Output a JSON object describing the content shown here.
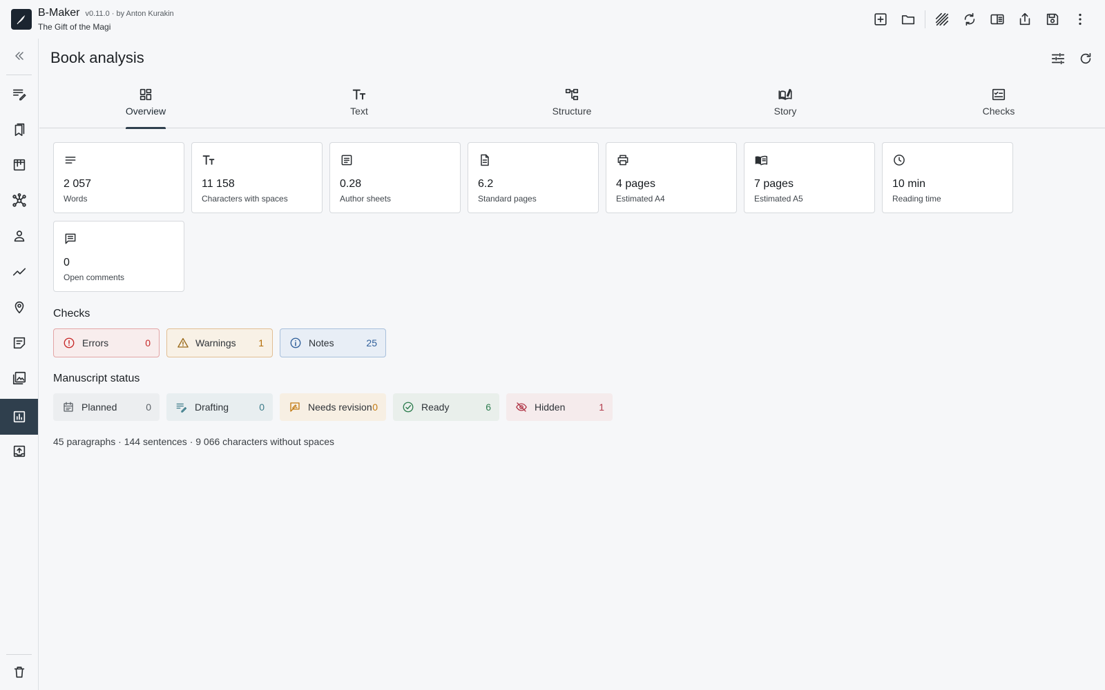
{
  "app": {
    "name": "B-Maker",
    "version": "v0.11.0 · by Anton Kurakin",
    "book_title": "The Gift of the Magi"
  },
  "header_actions": [
    "new-project-icon",
    "open-folder-icon",
    "texture-icon",
    "sync-icon",
    "split-view-icon",
    "share-icon",
    "save-icon",
    "more-vert-icon"
  ],
  "sidebar": {
    "items": [
      "collapse-icon",
      "edit-notes-icon",
      "bookmarks-icon",
      "board-icon",
      "network-icon",
      "person-icon",
      "timeline-icon",
      "location-icon",
      "notes-icon",
      "images-icon",
      "analytics-icon",
      "export-icon"
    ],
    "active": "analytics-icon",
    "bottom": "trash-icon"
  },
  "page": {
    "title": "Book analysis"
  },
  "tabs": [
    {
      "label": "Overview",
      "icon": "dashboard-icon"
    },
    {
      "label": "Text",
      "icon": "text-fields-icon"
    },
    {
      "label": "Structure",
      "icon": "structure-icon"
    },
    {
      "label": "Story",
      "icon": "story-icon"
    },
    {
      "label": "Checks",
      "icon": "checklist-icon"
    }
  ],
  "active_tab": "Overview",
  "stats": [
    {
      "value": "2 057",
      "label": "Words",
      "icon": "lines-icon"
    },
    {
      "value": "11 158",
      "label": "Characters with spaces",
      "icon": "text-fields-icon"
    },
    {
      "value": "0.28",
      "label": "Author sheets",
      "icon": "article-icon"
    },
    {
      "value": "6.2",
      "label": "Standard pages",
      "icon": "document-icon"
    },
    {
      "value": "4 pages",
      "label": "Estimated A4",
      "icon": "print-icon"
    },
    {
      "value": "7 pages",
      "label": "Estimated A5",
      "icon": "book-icon"
    },
    {
      "value": "10 min",
      "label": "Reading time",
      "icon": "clock-icon"
    },
    {
      "value": "0",
      "label": "Open comments",
      "icon": "comment-icon"
    }
  ],
  "checks": {
    "title": "Checks",
    "items": [
      {
        "label": "Errors",
        "count": "0",
        "color": "#c62828"
      },
      {
        "label": "Warnings",
        "count": "1",
        "color": "#b26a00"
      },
      {
        "label": "Notes",
        "count": "25",
        "color": "#2f5f9a"
      }
    ]
  },
  "manuscript_status": {
    "title": "Manuscript status",
    "items": [
      {
        "label": "Planned",
        "count": "0"
      },
      {
        "label": "Drafting",
        "count": "0"
      },
      {
        "label": "Needs revision",
        "count": "0"
      },
      {
        "label": "Ready",
        "count": "6"
      },
      {
        "label": "Hidden",
        "count": "1"
      }
    ]
  },
  "footer": "45 paragraphs · 144 sentences · 9 066 characters without spaces"
}
